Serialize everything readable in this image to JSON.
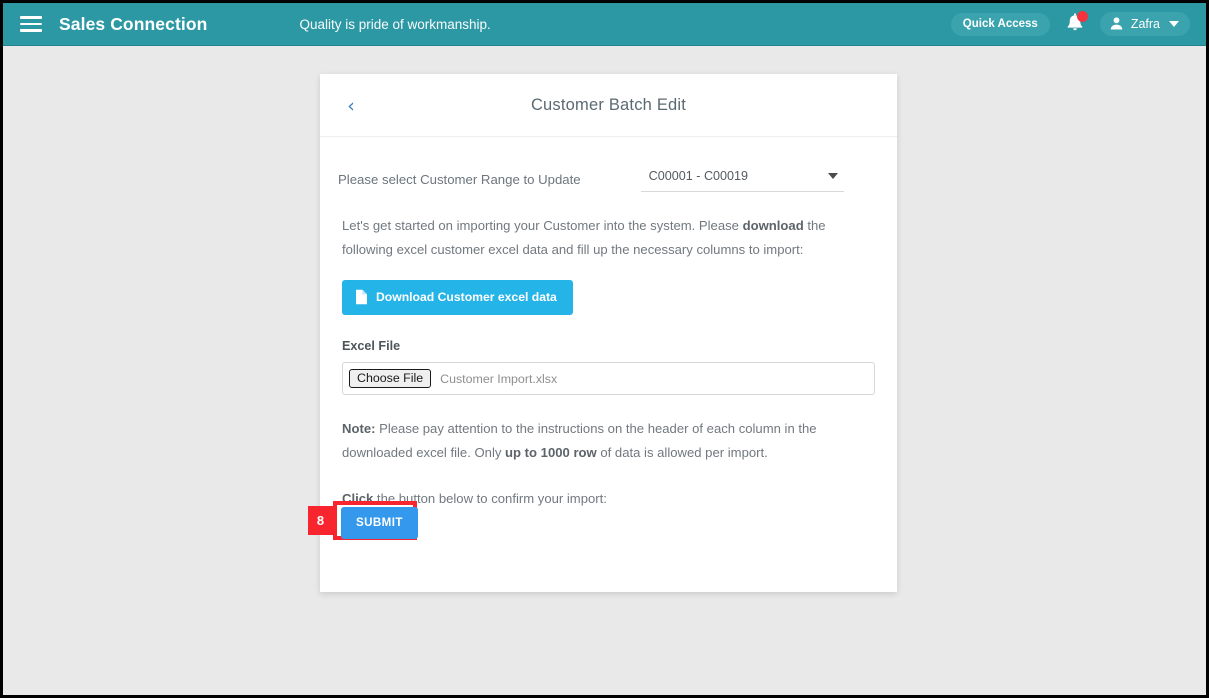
{
  "navbar": {
    "menu_icon": "hamburger-menu-icon",
    "brand": "Sales Connection",
    "tagline": "Quality is pride of workmanship.",
    "quick_access_label": "Quick Access",
    "notification_icon": "bell-icon",
    "notification_badge": "",
    "user_name": "Zafra",
    "user_icon": "person-icon",
    "caret_icon": "chevron-down-icon",
    "background_color": "#2c98a4"
  },
  "card": {
    "back_icon": "chevron-left-icon",
    "back_glyph": "‹",
    "title": "Customer Batch Edit",
    "range": {
      "label": "Please select Customer Range to Update",
      "selected_value": "C00001 - C00019",
      "caret_icon": "dropdown-caret-icon"
    },
    "intro": {
      "part1": "Let's get started on importing your Customer into the system. Please ",
      "bold1": "download",
      "part2": " the following excel customer excel data and fill up the necessary columns to import:"
    },
    "download_button": {
      "label": "Download Customer excel data",
      "icon": "file-document-icon",
      "color": "#25b4e8"
    },
    "excel_file": {
      "label": "Excel File",
      "choose_button_label": "Choose File",
      "file_name": "Customer Import.xlsx"
    },
    "note": {
      "bold1": "Note:",
      "part1": " Please pay attention to the instructions on the header of each column in the downloaded excel file. Only ",
      "bold2": "up to 1000 row",
      "part2": " of data is allowed per import."
    },
    "click_line": {
      "bold1": "Click",
      "part1": " the button below to confirm your import:"
    },
    "submit_button": {
      "label": "SUBMIT",
      "color": "#3498ec"
    }
  },
  "annotation": {
    "step_number": "8",
    "color": "#f8252f"
  }
}
